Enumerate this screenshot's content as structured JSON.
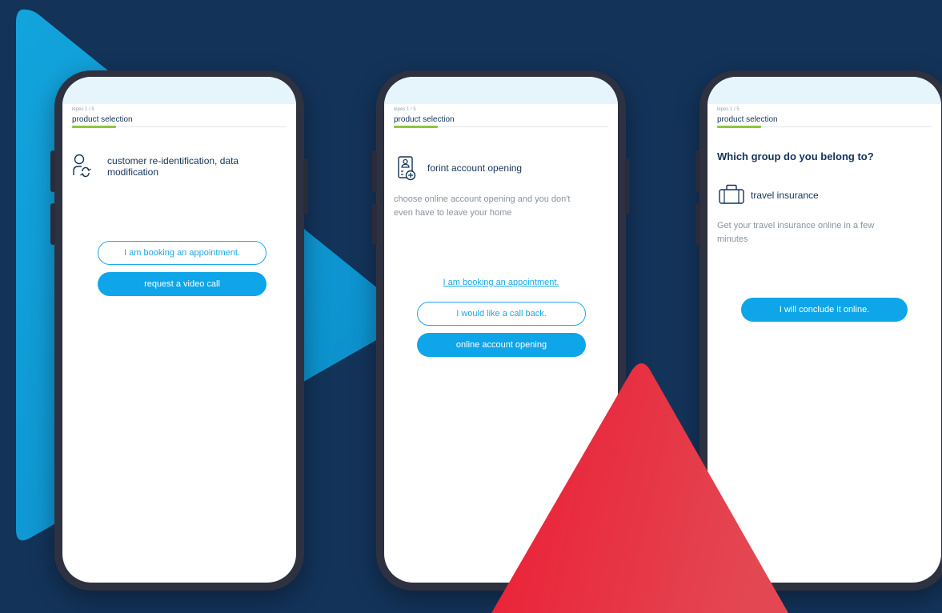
{
  "colors": {
    "background": "#133359",
    "accent_blue": "#0ea5e9",
    "progress_green": "#8cc63f",
    "deco_red": "#ef2a3a",
    "navy_text": "#133359"
  },
  "phones": [
    {
      "step": "lépés 1 / 5",
      "page_title": "product selection",
      "item_icon": "user-refresh-icon",
      "item_label_line1": "customer re-identification, data",
      "item_label_line2": "modification",
      "outline_button": "I am booking an appointment.",
      "solid_button": "request a video call"
    },
    {
      "step": "lépés 1 / 5",
      "page_title": "product selection",
      "item_icon": "document-user-add-icon",
      "item_label": "forint account opening",
      "description_line1": "choose online account opening and you don't",
      "description_line2": "even have to leave your home",
      "link": "I am booking an appointment.",
      "outline_button": "I would like a call back.",
      "solid_button": "online account opening"
    },
    {
      "step": "lépés 1 / 5",
      "page_title": "product selection",
      "heading": "Which group do you belong to?",
      "item_icon": "suitcase-icon",
      "item_label": "travel insurance",
      "description_line1": "Get your travel insurance online in a few",
      "description_line2": "minutes",
      "solid_button": "I will conclude it online."
    }
  ]
}
